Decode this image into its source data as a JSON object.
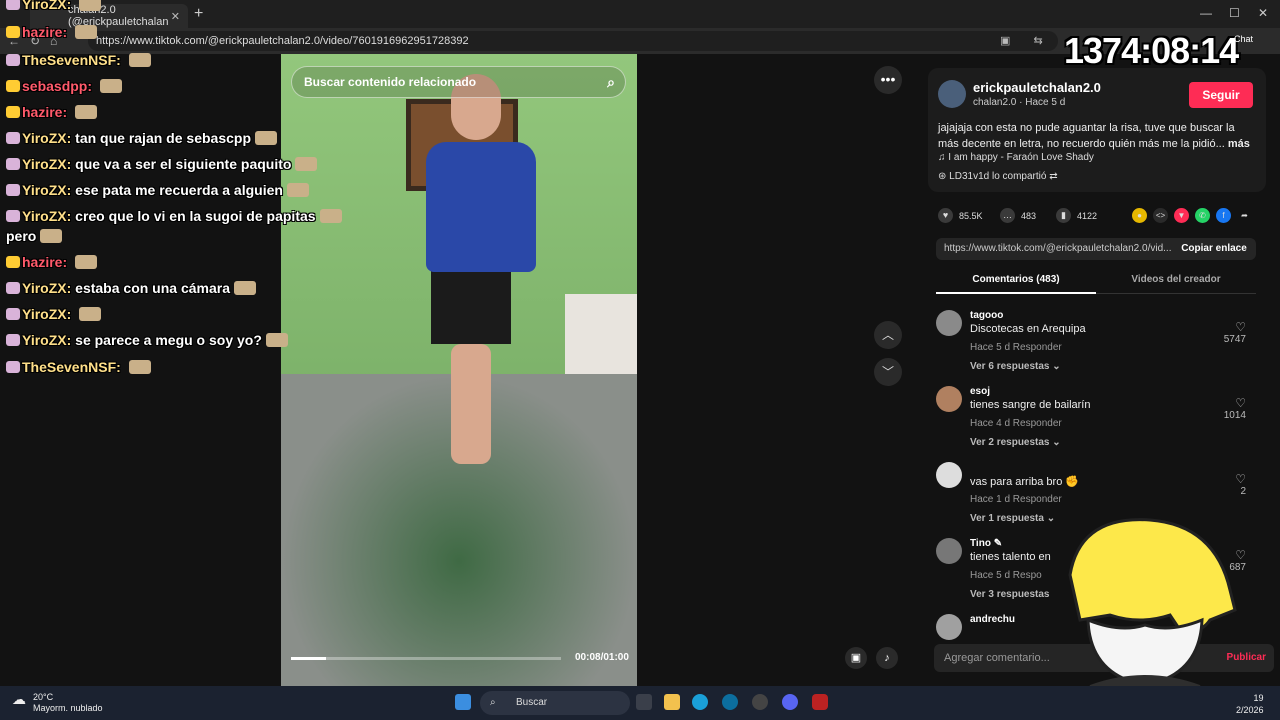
{
  "browser": {
    "tab_title": "chalan2.0 (@erickpauletchalan",
    "url": "https://www.tiktok.com/@erickpauletchalan2.0/video/7601916962951728392"
  },
  "chat": [
    {
      "user": "YiroZX:",
      "text": "",
      "top": 0,
      "color": "gold"
    },
    {
      "user": "hazire:",
      "text": "",
      "color": "red"
    },
    {
      "user": "TheSevenNSF:",
      "text": ""
    },
    {
      "user": "sebasdpp:",
      "text": "",
      "color": "red"
    },
    {
      "user": "hazire:",
      "text": "",
      "color": "red"
    },
    {
      "user": "YiroZX:",
      "text": "tan que rajan de sebascpp"
    },
    {
      "user": "YiroZX:",
      "text": "que va a ser el siguiente paquito"
    },
    {
      "user": "YiroZX:",
      "text": "ese pata me recuerda a alguien"
    },
    {
      "user": "YiroZX:",
      "text": "creo que lo vi en la sugoi de papitas"
    },
    {
      "user": "",
      "text": "pero"
    },
    {
      "user": "hazire:",
      "text": "",
      "color": "red"
    },
    {
      "user": "YiroZX:",
      "text": "estaba con una cámara"
    },
    {
      "user": "YiroZX:",
      "text": ""
    },
    {
      "user": "YiroZX:",
      "text": "se parece a megu o soy yo?"
    },
    {
      "user": "TheSevenNSF:",
      "text": ""
    }
  ],
  "video": {
    "search_placeholder": "Buscar contenido relacionado",
    "time": "00:08/01:00",
    "progress": 0.13
  },
  "post": {
    "username": "erickpauletchalan2.0",
    "subline": "chalan2.0 · Hace 5 d",
    "follow_label": "Seguir",
    "description": "jajajaja con esta no pude aguantar la risa, tuve que buscar la más decente en letra, no recuerdo quién más me la pidió...",
    "more_label": "más",
    "song": "♫  I am happy - Faraón Love Shady",
    "shared": "LD31v1d lo compartió",
    "likes": "85.5K",
    "comments": "483",
    "saves": "4122",
    "link": "https://www.tiktok.com/@erickpauletchalan2.0/vid...",
    "copy_label": "Copiar enlace",
    "tab_comments": "Comentarios (483)",
    "tab_videos": "Videos del creador",
    "add_comment": "Agregar comentario...",
    "publish": "Publicar"
  },
  "comments": [
    {
      "user": "tagooo",
      "text": "Discotecas en Arequipa",
      "meta": "Hace 5 d    Responder",
      "replies": "Ver 6 respuestas ⌄",
      "likes": "5747"
    },
    {
      "user": "esoj",
      "text": "tienes sangre de bailarín",
      "meta": "Hace 4 d    Responder",
      "replies": "Ver 2 respuestas ⌄",
      "likes": "1014"
    },
    {
      "user": "",
      "text": "vas para arriba bro ✊",
      "meta": "Hace 1 d    Responder",
      "replies": "Ver 1 respuesta ⌄",
      "likes": "2"
    },
    {
      "user": "Tino ✎",
      "text": "tienes talento en",
      "meta": "Hace 5 d    Respo",
      "replies": "Ver 3 respuestas",
      "likes": "687"
    },
    {
      "user": "andrechu",
      "text": "",
      "meta": "",
      "replies": "",
      "likes": ""
    }
  ],
  "overlay": {
    "timer": "1374:08:14",
    "chat_label": "Chat"
  },
  "taskbar": {
    "temp": "20°C",
    "weather": "Mayorm. nublado",
    "search": "Buscar",
    "clock_top": "19",
    "clock_bottom": "2/2026"
  },
  "colors": {
    "accent": "#fe2c55",
    "chat_user": "#ffe08a",
    "chat_user_red": "#ff5a6b"
  }
}
